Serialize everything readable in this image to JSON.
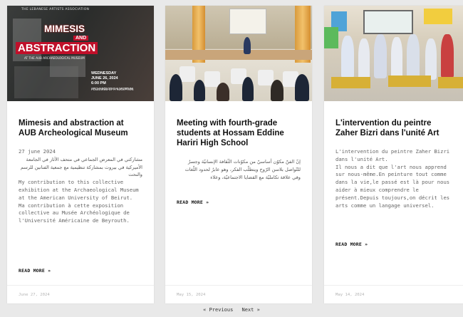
{
  "posts": [
    {
      "thumb": {
        "org": "THE LEBANESE ARTISTS ASSOCIATION",
        "line1": "MIMESIS",
        "and": "AND",
        "line2": "ABSTRACTION",
        "sub": "AT THE AUB ARCHAEOLOGICAL MUSEUM",
        "day": "WEDNESDAY",
        "date": "JUNE 26, 2024",
        "time": "6:00 PM",
        "venue": "ARCHAEOLOGICAL MUSEUM",
        "note": "FOLLOWED BY A RECEPTION"
      },
      "title": "Mimesis and abstraction at AUB Archeological Museum",
      "date_line": "27 june 2024",
      "arabic": "مشاركتي في المعرض الجماعي في متحف الآثار في الجامعة الأميركية في بيروت بمشاركة تنظيمية مع جمعية الفنانين للرسم والنحت",
      "text": "My contribution to this collective exhibition at the Archaeological Museum at the American University of Beirut.\nMa contribution à cette exposition collective au Musée Archéologique de l'Université Américaine de Beyrouth.",
      "read_more": "READ MORE »",
      "footer_date": "June 27, 2024"
    },
    {
      "title": "Meeting with fourth-grade students at Hossam Eddine Hariri High School",
      "arabic": "إنّ الفنّ مكوّن أساسيّ من مكوّنات الثّقافة الإنسانيّة وجسرٌ للتّواصل بلاسن الرّوح ويتطلّب الفكر، وهو عابرٌ لحدود اللّغات وفي علاقة تكامليّة مع القضايا الاجتماعيّة، وعلاء",
      "read_more": "READ MORE »",
      "footer_date": "May 15, 2024"
    },
    {
      "title": "L'intervention du peintre Zaher Bizri dans l'unité Art",
      "text": "L'intervention du peintre Zaher Bizri dans l'unité Art.\nIl nous a dit que l'art nous apprend sur nous-même.En peinture tout comme dans la vie,le passé est là pour nous aider à mieux comprendre le présent.Depuis toujours,on décrit les arts comme un langage universel.",
      "read_more": "READ MORE »",
      "footer_date": "May 14, 2024"
    }
  ],
  "pagination": {
    "previous": "« Previous",
    "next": "Next »"
  }
}
